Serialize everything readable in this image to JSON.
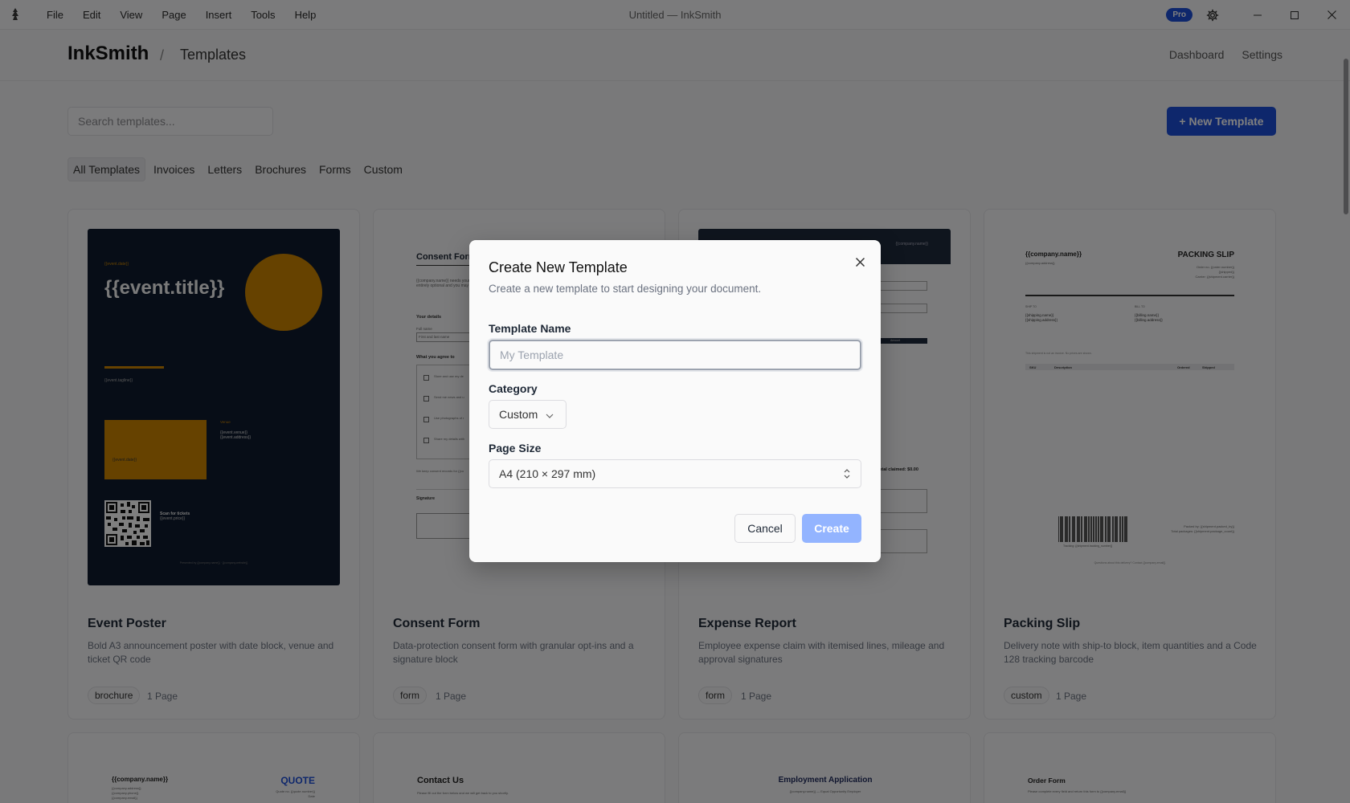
{
  "window": {
    "title": "Untitled — InkSmith",
    "menu": [
      "File",
      "Edit",
      "View",
      "Page",
      "Insert",
      "Tools",
      "Help"
    ],
    "pro_badge": "Pro"
  },
  "header": {
    "brand": "InkSmith",
    "separator": "/",
    "crumb": "Templates",
    "nav": [
      "Dashboard",
      "Settings"
    ]
  },
  "toolbar": {
    "search_placeholder": "Search templates...",
    "new_button": "+ New Template"
  },
  "tabs": [
    "All Templates",
    "Invoices",
    "Letters",
    "Brochures",
    "Forms",
    "Custom"
  ],
  "active_tab": "All Templates",
  "cards": [
    {
      "title": "Event Poster",
      "desc": "Bold A3 announcement poster with date block, venue and ticket QR code",
      "tag": "brochure",
      "pages": "1 Page"
    },
    {
      "title": "Consent Form",
      "desc": "Data-protection consent form with granular opt-ins and a signature block",
      "tag": "form",
      "pages": "1 Page"
    },
    {
      "title": "Expense Report",
      "desc": "Employee expense claim with itemised lines, mileage and approval signatures",
      "tag": "form",
      "pages": "1 Page"
    },
    {
      "title": "Packing Slip",
      "desc": "Delivery note with ship-to block, item quantities and a Code 128 tracking barcode",
      "tag": "custom",
      "pages": "1 Page"
    }
  ],
  "thumbs": {
    "poster": {
      "date": "{{event.date}}",
      "title": "{{event.title}}",
      "tagline": "{{event.tagline}}",
      "date_block": "{{event.date}}",
      "venue_label": "Venue",
      "venue": "{{event.venue}}",
      "address": "{{event.address}}",
      "scan": "Scan for tickets",
      "price": "{{event.price}}",
      "footer": "Presented by {{company.name}} · {{company.website}}",
      "bg": "#0f1b2e",
      "accent": "#cc8400"
    },
    "consent": {
      "title": "Consent Form",
      "intro1": "{{company.name}} needs your",
      "intro2": "entirely optional and you may c",
      "details": "Your details",
      "fullname": "Full name",
      "fullname_value": "First and last name",
      "agree": "What you agree to",
      "items": [
        "Store and use my de",
        "Send me news and u",
        "Use photographs of r",
        "Share my details with"
      ],
      "footer": "We keep consent records for {{co",
      "signature": "Signature"
    },
    "expense": {
      "company": "{{company.name}}",
      "amount_label": "Amount",
      "total": "otal claimed: $0.00"
    },
    "packing": {
      "company": "{{company.name}}",
      "address": "{{company.address}}",
      "title": "PACKING SLIP",
      "order": "Order no. {{order.number}}",
      "shipped": "{{shipped}}",
      "carrier": "Carrier: {{shipment.carrier}}",
      "shipto": "SHIP TO",
      "billto": "BILL TO",
      "ship_name": "{{shipping.name}}",
      "ship_addr": "{{shipping.address}}",
      "bill_name": "{{billing.name}}",
      "bill_addr": "{{billing.address}}",
      "note": "This shipment is not an invoice. No prices are shown.",
      "cols": [
        "SKU",
        "Description",
        "Ordered",
        "Shipped"
      ],
      "packed": "Packed by: {{shipment.packed_by}}",
      "packages": "Total packages: {{shipment.package_count}}",
      "tracking": "Tracking: {{shipment.tracking_number}}",
      "footer": "Questions about this delivery? Contact {{company.email}}"
    },
    "row2": {
      "quote_company": "{{company.name}}",
      "quote_addr": [
        "{{company.address}}",
        "{{company.phone}}",
        "{{company.email}}"
      ],
      "quote_title": "QUOTE",
      "quote_no": "Quote no. {{quote.number}}",
      "quote_date": "Date",
      "contact_title": "Contact Us",
      "contact_sub": "Please fill out the form below and we will get back to you shortly.",
      "emp_title": "Employment Application",
      "emp_sub": "{{company.name}} — Equal Opportunity Employer",
      "order_title": "Order Form",
      "order_sub": "Please complete every field and return this form to {{company.email}}"
    }
  },
  "modal": {
    "title": "Create New Template",
    "subtitle": "Create a new template to start designing your document.",
    "name_label": "Template Name",
    "name_placeholder": "My Template",
    "category_label": "Category",
    "category_value": "Custom",
    "size_label": "Page Size",
    "size_value": "A4 (210 × 297 mm)",
    "cancel": "Cancel",
    "create": "Create"
  },
  "colors": {
    "primary": "#1d4ed8",
    "create_disabled": "#93b4ff",
    "overlay": "rgba(0,0,0,0.5)"
  }
}
